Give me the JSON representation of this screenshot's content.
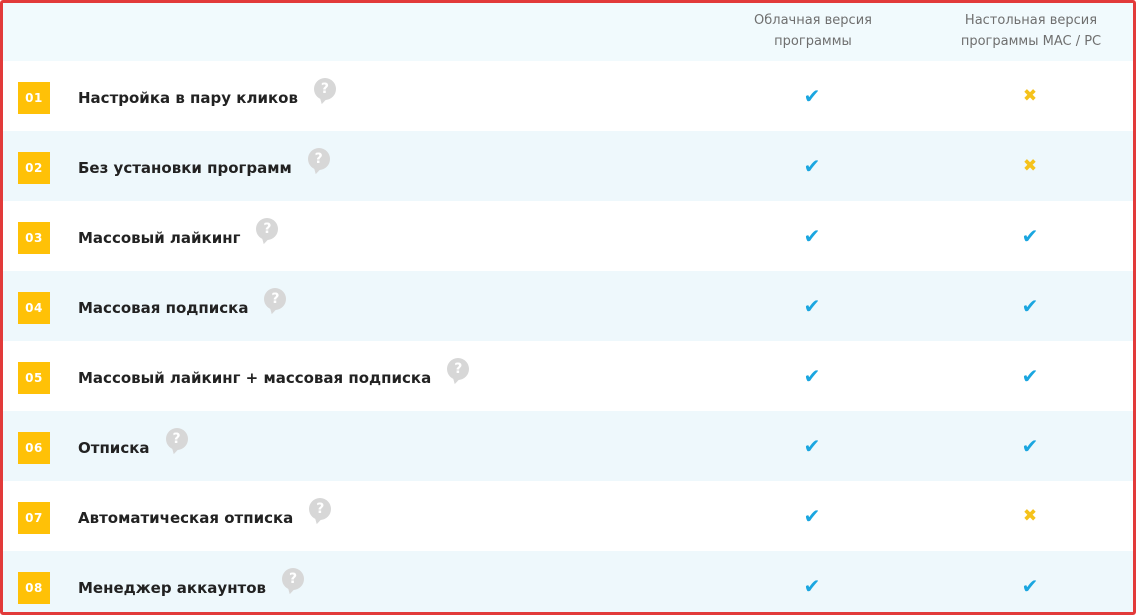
{
  "header": {
    "col1": "Облачная версия\nпрограммы",
    "col2": "Настольная версия\nпрограммы MAC / PC"
  },
  "colors": {
    "border": "#e23a3a",
    "number_badge": "#ffc107",
    "check": "#1aa6e0",
    "cross": "#f5c21b",
    "help_icon": "#d7d7d7"
  },
  "rows": [
    {
      "num": "01",
      "label": "Настройка в пару кликов",
      "cloud": true,
      "desktop": false
    },
    {
      "num": "02",
      "label": "Без установки программ",
      "cloud": true,
      "desktop": false
    },
    {
      "num": "03",
      "label": "Массовый лайкинг",
      "cloud": true,
      "desktop": true
    },
    {
      "num": "04",
      "label": "Массовая подписка",
      "cloud": true,
      "desktop": true
    },
    {
      "num": "05",
      "label": "Массовый лайкинг + массовая подписка",
      "cloud": true,
      "desktop": true
    },
    {
      "num": "06",
      "label": "Отписка",
      "cloud": true,
      "desktop": true
    },
    {
      "num": "07",
      "label": "Автоматическая отписка",
      "cloud": true,
      "desktop": false
    },
    {
      "num": "08",
      "label": "Менеджер аккаунтов",
      "cloud": true,
      "desktop": true
    }
  ],
  "icons": {
    "yes": "check-icon",
    "no": "cross-icon",
    "help": "help-icon"
  }
}
